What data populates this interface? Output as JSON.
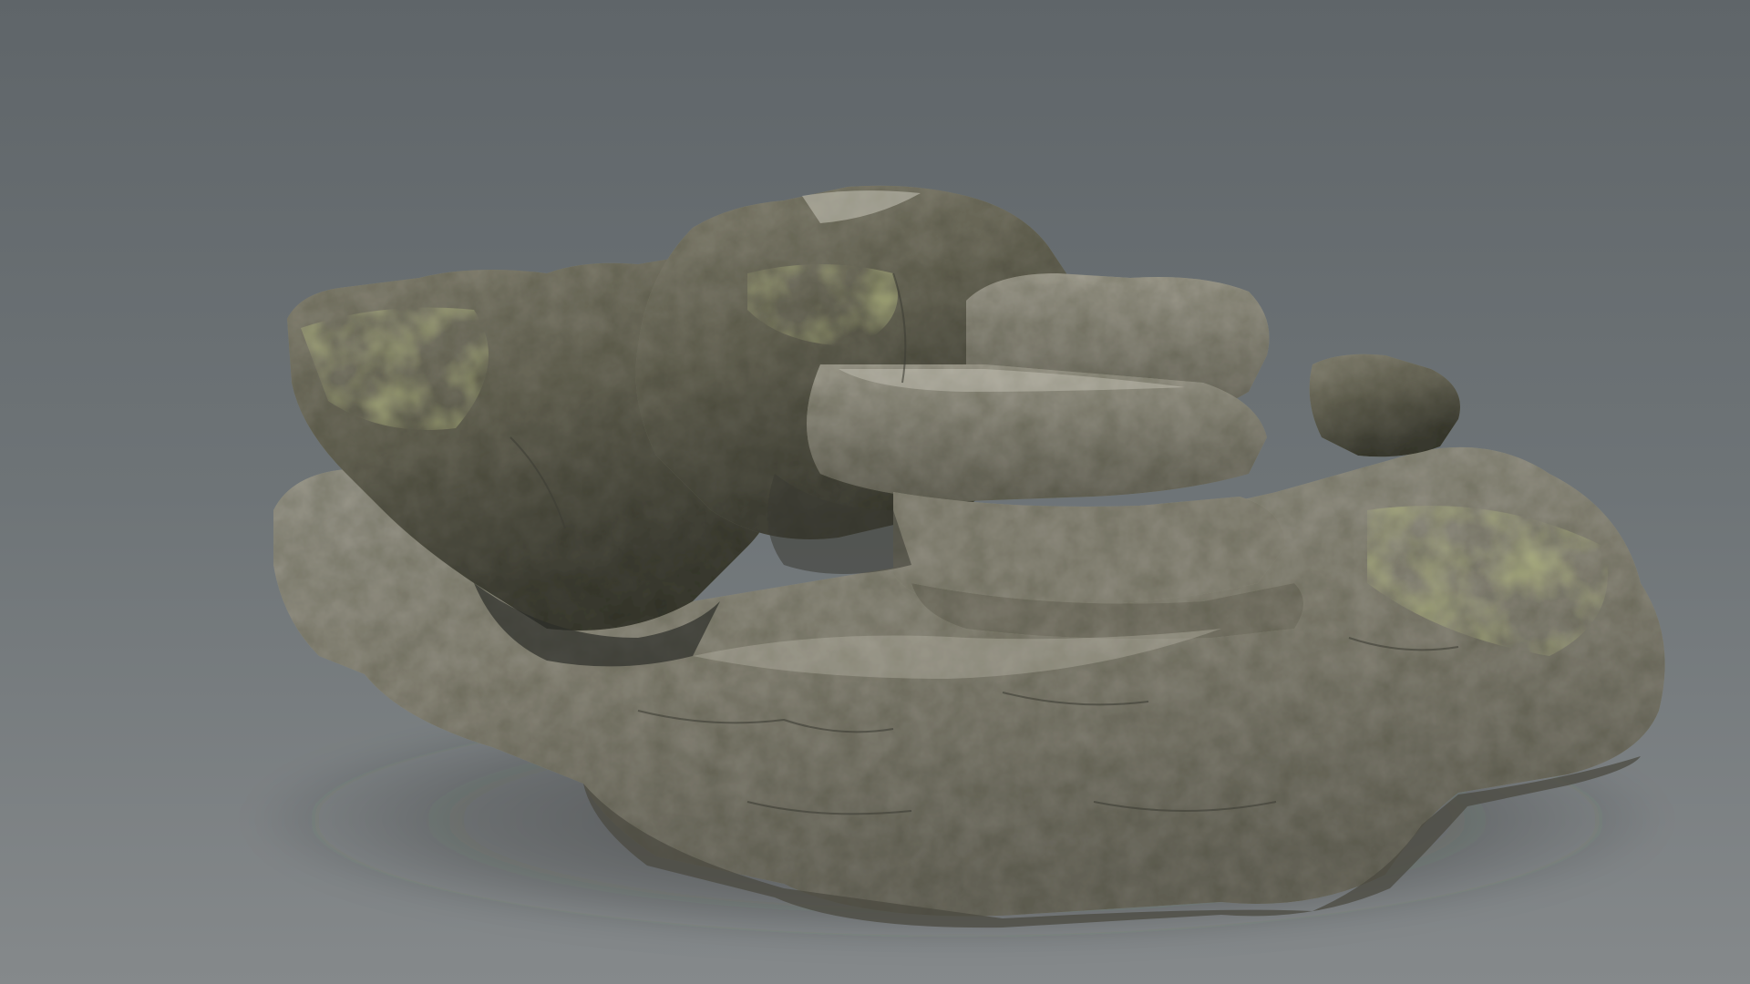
{
  "scene": {
    "background_top": "#5f6569",
    "background_mid": "#6e7477",
    "background_bottom": "#85898b",
    "rock_light": "#aeab9f",
    "rock_mid": "#7d7a6c",
    "rock_dark": "#4a4a3e",
    "moss": "#727a3c",
    "shadow": "#2c2e2a"
  },
  "visible_text": []
}
